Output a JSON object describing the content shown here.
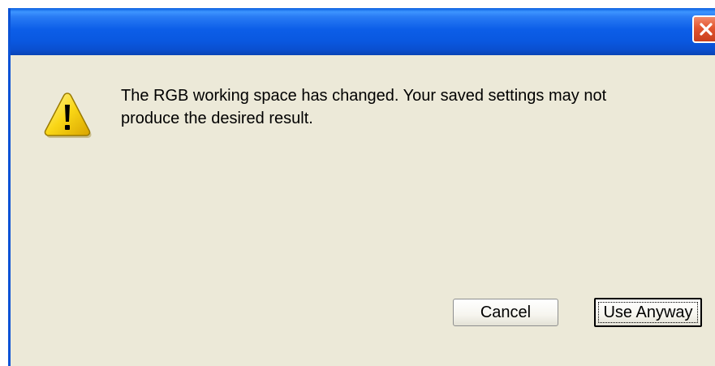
{
  "dialog": {
    "title": "",
    "message": "The RGB working space has changed. Your saved settings may not\nproduce the desired result.",
    "icon": "warning-icon",
    "buttons": {
      "cancel_label": "Cancel",
      "use_anyway_label": "Use Anyway"
    }
  },
  "colors": {
    "titlebar": "#0a58e0",
    "dialog_background": "#ece9d8",
    "close_button": "#e2552f",
    "warning_yellow": "#f9d616"
  }
}
